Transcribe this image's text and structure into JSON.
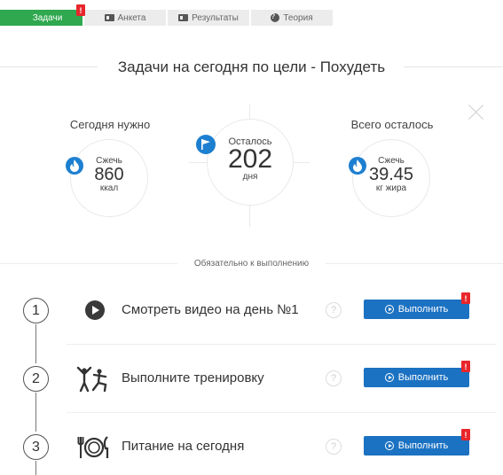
{
  "tabs": [
    {
      "label": "Задачи",
      "icon": "grid-icon",
      "active": true
    },
    {
      "label": "Анкета",
      "icon": "id-card-icon"
    },
    {
      "label": "Результаты",
      "icon": "id-card-icon"
    },
    {
      "label": "Теория",
      "icon": "question-circle-icon"
    }
  ],
  "alert_badge": "!",
  "page_title": "Задачи на сегодня по цели - Похудеть",
  "stats": {
    "today": {
      "heading": "Сегодня нужно",
      "action": "Сжечь",
      "value": "860",
      "unit": "ккал"
    },
    "remaining_days": {
      "label": "Осталось",
      "value": "202",
      "unit": "дня"
    },
    "total_left": {
      "heading": "Всего осталось",
      "action": "Сжечь",
      "value": "39.45",
      "unit": "кг жира"
    }
  },
  "section_title": "Обязательно к выполнению",
  "tasks": [
    {
      "number": "1",
      "label": "Смотреть видео на день №1",
      "icon": "play-icon",
      "help": "?",
      "button": "Выполнить"
    },
    {
      "number": "2",
      "label": "Выполните тренировку",
      "icon": "workout-icon",
      "help": "?",
      "button": "Выполнить"
    },
    {
      "number": "3",
      "label": "Питание на сегодня",
      "icon": "plate-cutlery-icon",
      "help": "?",
      "button": "Выполнить"
    }
  ],
  "colors": {
    "active_tab": "#2fa84f",
    "accent_blue": "#1c72c2",
    "badge_red": "#e8262b"
  }
}
